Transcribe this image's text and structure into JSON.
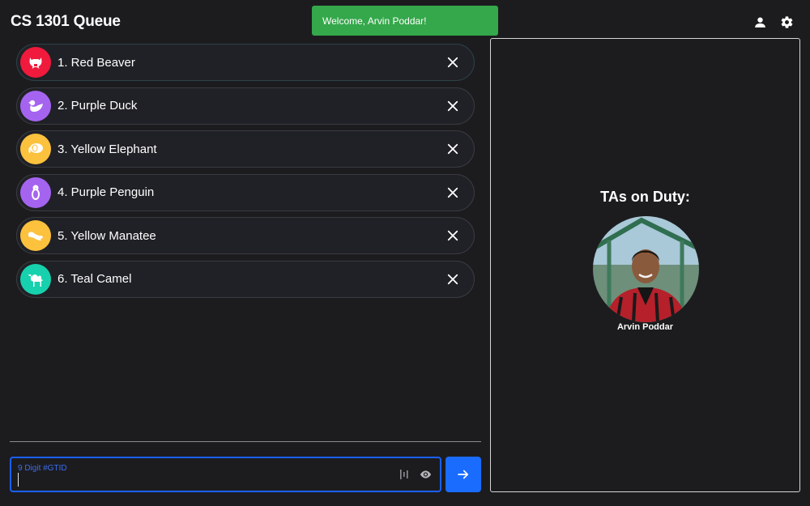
{
  "header": {
    "title": "CS 1301 Queue",
    "icons": [
      "user-icon",
      "gear-icon"
    ]
  },
  "toast": {
    "message": "Welcome, Arvin Poddar!"
  },
  "queue": {
    "items": [
      {
        "label": "1. Red Beaver",
        "color": "#f01a3c",
        "icon": "beaver-icon"
      },
      {
        "label": "2. Purple Duck",
        "color": "#a564f0",
        "icon": "duck-icon"
      },
      {
        "label": "3. Yellow Elephant",
        "color": "#fcc13d",
        "icon": "elephant-icon"
      },
      {
        "label": "4. Purple Penguin",
        "color": "#a564f0",
        "icon": "penguin-icon"
      },
      {
        "label": "5. Yellow Manatee",
        "color": "#fcc13d",
        "icon": "manatee-icon"
      },
      {
        "label": "6. Teal Camel",
        "color": "#17d1ae",
        "icon": "camel-icon"
      }
    ]
  },
  "gtid_input": {
    "placeholder": "9 Digit #GTID",
    "value": ""
  },
  "tas": {
    "title": "TAs on Duty:",
    "members": [
      {
        "name": "Arvin Poddar"
      }
    ]
  },
  "colors": {
    "background": "#1c1c1f",
    "accent": "#1a6cff",
    "toast": "#34a84a"
  }
}
